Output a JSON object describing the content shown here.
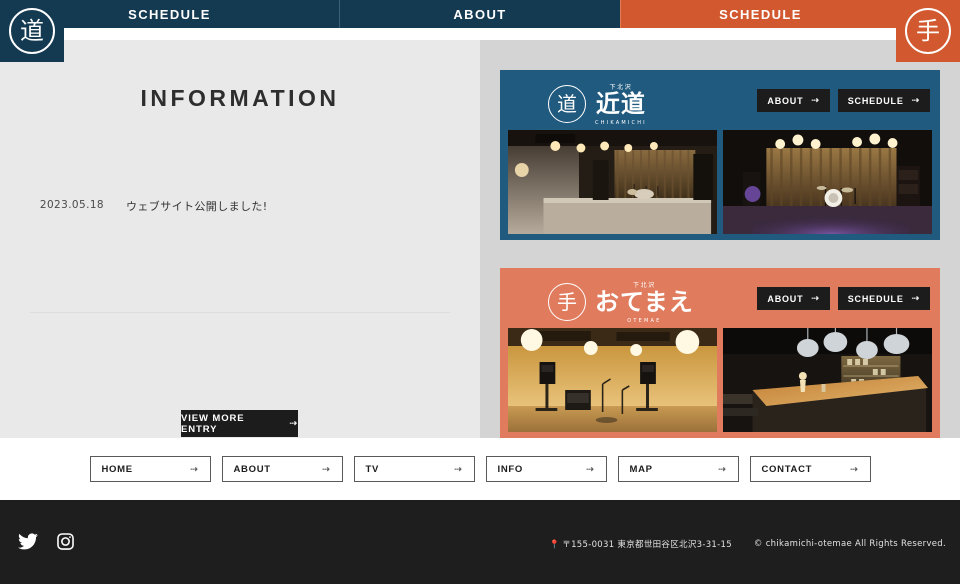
{
  "header": {
    "nav": [
      {
        "label": "SCHEDULE",
        "brand": "chikamichi"
      },
      {
        "label": "ABOUT",
        "brand": "chikamichi"
      },
      {
        "label": "SCHEDULE",
        "brand": "otemae"
      }
    ],
    "badge_left_glyph": "道",
    "badge_right_glyph": "手"
  },
  "colors": {
    "navy": "#143a52",
    "navy_card": "#205a7e",
    "orange": "#d2592f",
    "orange_card": "#e07b5d",
    "left_bg": "#e9e9e9",
    "right_bg": "#d4d4d4",
    "footer_bg": "#1e1e1e",
    "button_dark": "#1c1c1c"
  },
  "information": {
    "title": "INFORMATION",
    "entries": [
      {
        "date": "2023.05.18",
        "text": "ウェブサイト公開しました!"
      }
    ],
    "more_button": "VIEW MORE ENTRY",
    "arrow": "⇢"
  },
  "venues": [
    {
      "id": "chikamichi",
      "logo_glyph": "道",
      "logo_sup": "下北沢",
      "logo_main": "近道",
      "logo_sub": "CHIKAMICHI",
      "buttons": [
        {
          "label": "ABOUT",
          "arrow": "⇢"
        },
        {
          "label": "SCHEDULE",
          "arrow": "⇢"
        }
      ],
      "photos": [
        {
          "alt": "live-house-stage-concrete"
        },
        {
          "alt": "live-house-stage-drums"
        }
      ]
    },
    {
      "id": "otemae",
      "logo_glyph": "手",
      "logo_sup": "下北沢",
      "logo_main": "おてまえ",
      "logo_sub": "OTEMAE",
      "buttons": [
        {
          "label": "ABOUT",
          "arrow": "⇢"
        },
        {
          "label": "SCHEDULE",
          "arrow": "⇢"
        }
      ],
      "photos": [
        {
          "alt": "rehearsal-room-speakers"
        },
        {
          "alt": "bar-counter-pendant-lights"
        }
      ]
    }
  ],
  "footer_nav": [
    {
      "label": "HOME",
      "arrow": "⇢"
    },
    {
      "label": "ABOUT",
      "arrow": "⇢"
    },
    {
      "label": "TV",
      "arrow": "⇢"
    },
    {
      "label": "INFO",
      "arrow": "⇢"
    },
    {
      "label": "MAP",
      "arrow": "⇢"
    },
    {
      "label": "CONTACT",
      "arrow": "⇢"
    }
  ],
  "footer": {
    "socials": [
      "twitter-icon",
      "instagram-icon"
    ],
    "address": "〒155-0031 東京都世田谷区北沢3-31-15",
    "copyright": "© chikamichi-otemae All Rights Reserved."
  }
}
